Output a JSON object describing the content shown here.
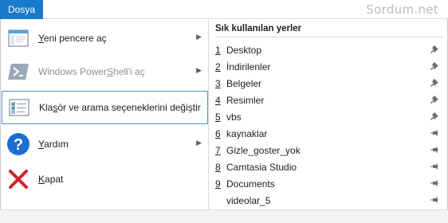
{
  "ribbon": {
    "file_tab": "Dosya",
    "watermark": "Sordum.net"
  },
  "menu": {
    "items": [
      {
        "pre": "",
        "accel": "Y",
        "post": "eni pencere aç",
        "icon": "new-window-icon",
        "submenu": true,
        "disabled": false,
        "selected": false
      },
      {
        "pre": "Windows Power",
        "accel": "S",
        "post": "hell'i aç",
        "icon": "powershell-icon",
        "submenu": true,
        "disabled": true,
        "selected": false
      },
      {
        "pre": "Kla",
        "accel": "s",
        "post": "ör ve arama seçeneklerini değiştir",
        "icon": "folder-options-icon",
        "submenu": false,
        "disabled": false,
        "selected": true
      },
      {
        "pre": "",
        "accel": "Y",
        "post": "ardım",
        "icon": "help-icon",
        "submenu": true,
        "disabled": false,
        "selected": false
      },
      {
        "pre": "",
        "accel": "K",
        "post": "apat",
        "icon": "close-icon",
        "submenu": false,
        "disabled": false,
        "selected": false
      }
    ]
  },
  "recent": {
    "title": "Sık kullanılan yerler",
    "items": [
      {
        "num": "1",
        "name": "Desktop",
        "pinned": true
      },
      {
        "num": "2",
        "name": "İndirilenler",
        "pinned": true
      },
      {
        "num": "3",
        "name": "Belgeler",
        "pinned": true
      },
      {
        "num": "4",
        "name": "Resimler",
        "pinned": true
      },
      {
        "num": "5",
        "name": "vbs",
        "pinned": true
      },
      {
        "num": "6",
        "name": "kaynaklar",
        "pinned": false
      },
      {
        "num": "7",
        "name": "Gizle_goster_yok",
        "pinned": false
      },
      {
        "num": "8",
        "name": "Camtasia Studio",
        "pinned": false
      },
      {
        "num": "9",
        "name": "Documents",
        "pinned": false
      },
      {
        "num": "",
        "name": "videolar_5",
        "pinned": false
      }
    ]
  },
  "colors": {
    "accent": "#1979ca",
    "selection_border": "#4d96db",
    "help_blue": "#1c6fd1",
    "close_red": "#d0232b"
  }
}
